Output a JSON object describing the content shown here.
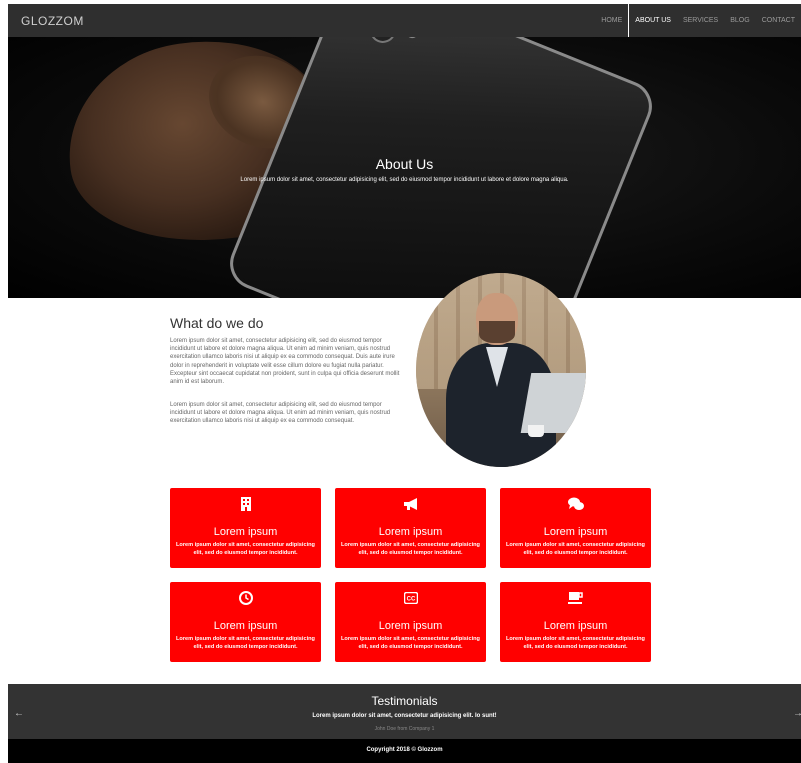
{
  "brand": "GLOZZOM",
  "nav": {
    "items": [
      {
        "label": "HOME",
        "active": false
      },
      {
        "label": "ABOUT US",
        "active": true
      },
      {
        "label": "SERVICES",
        "active": false
      },
      {
        "label": "BLOG",
        "active": false
      },
      {
        "label": "CONTACT",
        "active": false
      }
    ]
  },
  "hero": {
    "title": "About Us",
    "subtitle": "Lorem ipsum dolor sit amet, consectetur adipisicing elit, sed do eiusmod tempor incididunt ut labore et dolore magna aliqua."
  },
  "what": {
    "title": "What do we do",
    "p1": "Lorem ipsum dolor sit amet, consectetur adipisicing elit, sed do eiusmod tempor incididunt ut labore et dolore magna aliqua. Ut enim ad minim veniam, quis nostrud exercitation ullamco laboris nisi ut aliquip ex ea commodo consequat. Duis aute irure dolor in reprehenderit in voluptate velit esse cillum dolore eu fugiat nulla pariatur. Excepteur sint occaecat cupidatat non proident, sunt in culpa qui officia deserunt mollit anim id est laborum.",
    "p2": "Lorem ipsum dolor sit amet, consectetur adipisicing elit, sed do eiusmod tempor incididunt ut labore et dolore magna aliqua. Ut enim ad minim veniam, quis nostrud exercitation ullamco laboris nisi ut aliquip ex ea commodo consequat."
  },
  "features": [
    {
      "icon": "building-icon",
      "title": "Lorem ipsum",
      "text": "Lorem ipsum dolor sit amet, consectetur adipisicing elit, sed do eiusmod tempor incididunt."
    },
    {
      "icon": "bullhorn-icon",
      "title": "Lorem ipsum",
      "text": "Lorem ipsum dolor sit amet, consectetur adipisicing elit, sed do eiusmod tempor incididunt."
    },
    {
      "icon": "comments-icon",
      "title": "Lorem ipsum",
      "text": "Lorem ipsum dolor sit amet, consectetur adipisicing elit, sed do eiusmod tempor incididunt."
    },
    {
      "icon": "clock-icon",
      "title": "Lorem ipsum",
      "text": "Lorem ipsum dolor sit amet, consectetur adipisicing elit, sed do eiusmod tempor incididunt."
    },
    {
      "icon": "closed-captioning-icon",
      "title": "Lorem ipsum",
      "text": "Lorem ipsum dolor sit amet, consectetur adipisicing elit, sed do eiusmod tempor incididunt."
    },
    {
      "icon": "coffee-icon",
      "title": "Lorem ipsum",
      "text": "Lorem ipsum dolor sit amet, consectetur adipisicing elit, sed do eiusmod tempor incididunt."
    }
  ],
  "testimonials": {
    "title": "Testimonials",
    "quote": "Lorem ipsum dolor sit amet, consectetur adipisicing elit. Io sunt!",
    "author": "John Doe from Company 1",
    "prev_arrow": "←",
    "next_arrow": "→"
  },
  "footer": {
    "copyright": "Copyright 2018 © Glozzom"
  },
  "colors": {
    "accent": "#ff0000",
    "nav_bg": "#2f2f2f",
    "testimonials_bg": "#333333",
    "footer_bg": "#000000"
  }
}
